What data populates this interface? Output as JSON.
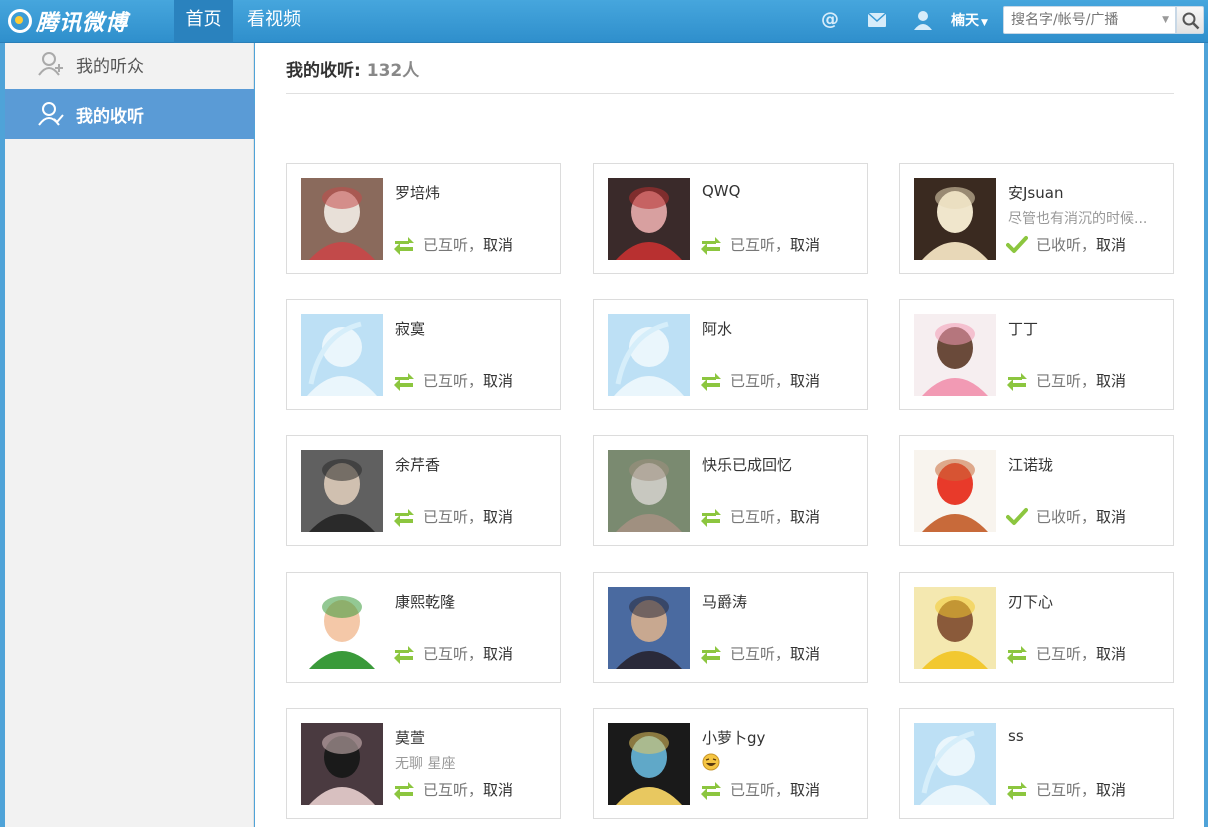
{
  "app": {
    "logo_text": "腾讯微博",
    "nav": [
      "首页",
      "看视频"
    ],
    "username": "楠天",
    "search_placeholder": "搜名字/帐号/广播",
    "colors": {
      "topbar": "#3a9ad6",
      "accent": "#5a9bd6",
      "mutual_icon": "#8cc63f"
    }
  },
  "sidebar": {
    "items": [
      {
        "label": "我的听众",
        "icon": "user-add-icon",
        "active": false
      },
      {
        "label": "我的收听",
        "icon": "user-check-icon",
        "active": true
      }
    ]
  },
  "main": {
    "title": "我的收听:",
    "count": "132人",
    "cancel_label": "取消",
    "users": [
      {
        "name": "罗培炜",
        "desc": "",
        "status": "已互听，",
        "status_type": "mutual",
        "avatar": "photo"
      },
      {
        "name": "QWQ",
        "desc": "",
        "status": "已互听，",
        "status_type": "mutual",
        "avatar": "photo"
      },
      {
        "name": "安Jsuan",
        "desc": "尽管也有消沉的时候...",
        "status": "已收听，",
        "status_type": "following",
        "avatar": "photo"
      },
      {
        "name": "寂寞",
        "desc": "",
        "status": "已互听，",
        "status_type": "mutual",
        "avatar": "default"
      },
      {
        "name": "阿水",
        "desc": "",
        "status": "已互听，",
        "status_type": "mutual",
        "avatar": "default"
      },
      {
        "name": "丁丁",
        "desc": "",
        "status": "已互听，",
        "status_type": "mutual",
        "avatar": "photo"
      },
      {
        "name": "余芹香",
        "desc": "",
        "status": "已互听，",
        "status_type": "mutual",
        "avatar": "photo"
      },
      {
        "name": "快乐已成回忆",
        "desc": "",
        "status": "已互听，",
        "status_type": "mutual",
        "avatar": "photo"
      },
      {
        "name": "江诺珑",
        "desc": "",
        "status": "已收听，",
        "status_type": "following",
        "avatar": "photo"
      },
      {
        "name": "康熙乾隆",
        "desc": "",
        "status": "已互听，",
        "status_type": "mutual",
        "avatar": "photo"
      },
      {
        "name": "马爵涛",
        "desc": "",
        "status": "已互听，",
        "status_type": "mutual",
        "avatar": "photo"
      },
      {
        "name": "刃下心",
        "desc": "",
        "status": "已互听，",
        "status_type": "mutual",
        "avatar": "photo"
      },
      {
        "name": "莫萱",
        "desc": "无聊 星座",
        "status": "已互听，",
        "status_type": "mutual",
        "avatar": "photo"
      },
      {
        "name": "小萝卜gy",
        "desc": "",
        "status": "已互听，",
        "status_type": "mutual",
        "avatar": "photo",
        "emoji": "laughing-emoji-icon"
      },
      {
        "name": "ss",
        "desc": "",
        "status": "已互听，",
        "status_type": "mutual",
        "avatar": "default"
      }
    ]
  }
}
